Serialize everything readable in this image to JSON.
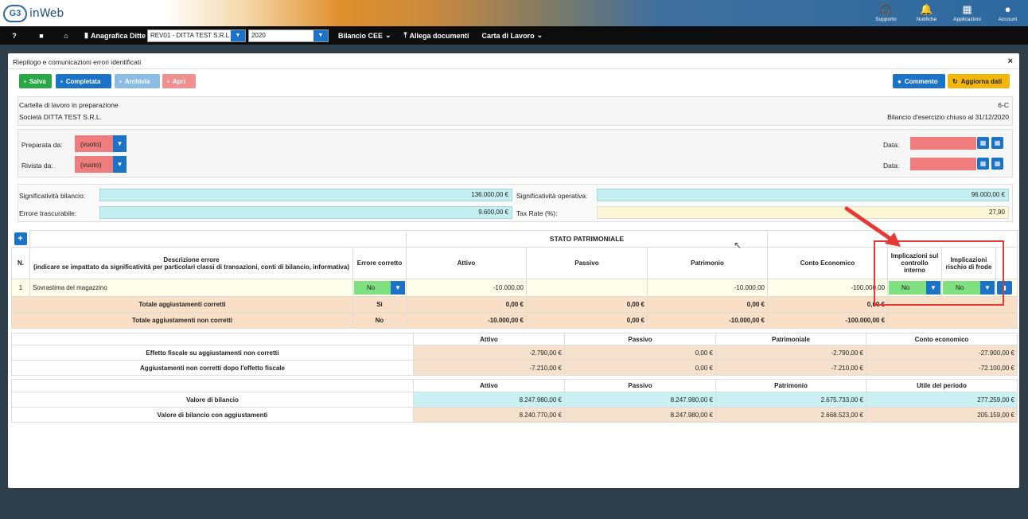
{
  "app": {
    "name": "inWeb",
    "logo_text": "G3"
  },
  "top_icons": [
    {
      "icon": "headset-icon",
      "label": "Supporto"
    },
    {
      "icon": "bell-icon",
      "label": "Notifiche"
    },
    {
      "icon": "grid-icon",
      "label": "Applicazioni"
    },
    {
      "icon": "account-icon",
      "label": "Account"
    }
  ],
  "menu": {
    "help": "?",
    "anagrafica": "Anagrafica Ditte",
    "company_select": "REV01 - DITTA TEST S.R.L.",
    "year_select": "2020",
    "bilancio": "Bilancio CEE",
    "allega": "Allega documenti",
    "carta": "Carta di Lavoro"
  },
  "panel": {
    "title": "Riepilogo e comunicazioni errori identificati",
    "close": "×",
    "buttons": {
      "salva": "Salva",
      "completata": "Completata",
      "archivia": "Archivia",
      "apri": "Apri",
      "commento": "Commento",
      "aggiorna": "Aggiorna dati"
    },
    "status": "Cartella di lavoro in preparazione",
    "code": "6-C",
    "company": "Società DITTA TEST S.R.L.",
    "bilancio_note": "Bilancio d'esercizio chiuso al 31/12/2020",
    "preparata_label": "Preparata da:",
    "rivista_label": "Rivista da:",
    "empty_value": "(vuoto)",
    "data_label": "Data:",
    "sig_bilancio_label": "Significatività bilancio:",
    "sig_bilancio_value": "136.000,00 €",
    "sig_operativa_label": "Significatività operativa:",
    "sig_operativa_value": "96.000,00 €",
    "errore_label": "Errore trascurabile:",
    "errore_value": "9.600,00 €",
    "tax_label": "Tax Rate (%):",
    "tax_value": "27,90"
  },
  "errors_table": {
    "add": "+",
    "stato_patrimoniale": "STATO PATRIMONIALE",
    "headers": {
      "n": "N.",
      "descrizione": "Descrizione errore",
      "descrizione_sub": "(indicare se impattato da significatività per particolari classi di transazioni, conti di bilancio, informativa)",
      "errore_corretto": "Errore corretto",
      "attivo": "Attivo",
      "passivo": "Passivo",
      "patrimonio": "Patrimonio",
      "conto": "Conto Economico",
      "controllo": "Implicazioni sul controllo interno",
      "frode": "Implicazioni rischio di frode"
    },
    "row": {
      "n": "1",
      "descrizione": "Sovrastima del magazzino",
      "corretto": "No",
      "attivo": "-10.000,00",
      "passivo": "",
      "patrimonio": "-10.000,00",
      "conto": "-100.000,00",
      "controllo": "No",
      "frode": "No"
    },
    "tot_corretti": {
      "label": "Totale aggiustamenti corretti",
      "flag": "Sì",
      "attivo": "0,00 €",
      "passivo": "0,00 €",
      "patrimonio": "0,00 €",
      "conto": "0,00 €"
    },
    "tot_non_corretti": {
      "label": "Totale aggiustamenti non corretti",
      "flag": "No",
      "attivo": "-10.000,00 €",
      "passivo": "0,00 €",
      "patrimonio": "-10.000,00 €",
      "conto": "-100.000,00 €"
    }
  },
  "effect_table": {
    "headers": [
      "Attivo",
      "Passivo",
      "Patrimoniale",
      "Conto economico"
    ],
    "rows": [
      {
        "label": "Effetto fiscale su aggiustamenti non corretti",
        "values": [
          "-2.790,00 €",
          "0,00 €",
          "-2.790,00 €",
          "-27.900,00 €"
        ]
      },
      {
        "label": "Aggiustamenti non corretti dopo l'effetto fiscale",
        "values": [
          "-7.210,00 €",
          "0,00 €",
          "-7.210,00 €",
          "-72.100,00 €"
        ]
      }
    ]
  },
  "value_table": {
    "headers": [
      "Attivo",
      "Passivo",
      "Patrimonio",
      "Utile del periodo"
    ],
    "rows": [
      {
        "label": "Valore di bilancio",
        "values": [
          "8.247.980,00 €",
          "8.247.980,00 €",
          "2.675.733,00 €",
          "277.259,00 €"
        ]
      },
      {
        "label": "Valore di bilancio con aggiustamenti",
        "values": [
          "8.240.770,00 €",
          "8.247.980,00 €",
          "2.668.523,00 €",
          "205.159,00 €"
        ]
      }
    ]
  },
  "colors": {
    "primary": "#1a73c6",
    "success": "#27a844",
    "danger": "#ef7d7d",
    "warning": "#f5b60a",
    "highlight": "#e53935"
  }
}
